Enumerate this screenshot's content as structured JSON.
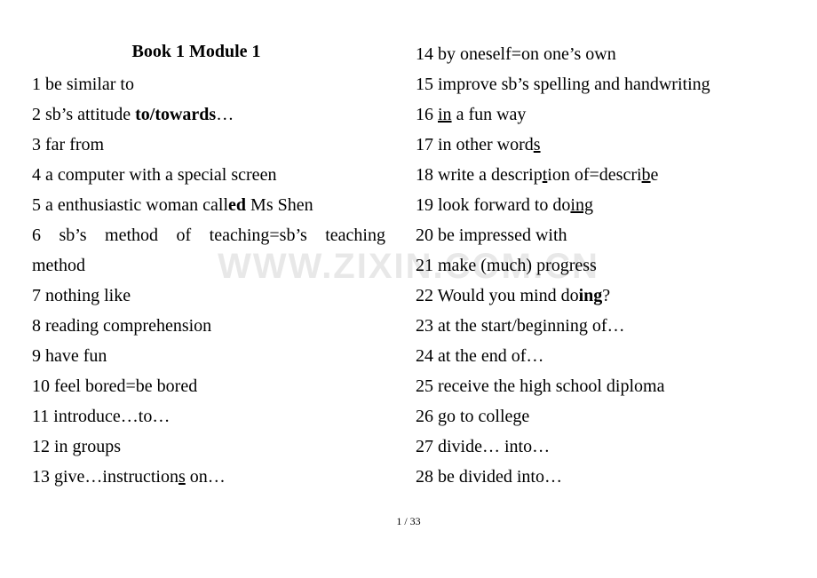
{
  "document": {
    "title": "Book 1 Module 1",
    "watermark": "WWW.ZIXIN.COM.CN",
    "footer": "1 / 33",
    "left_column": [
      "1 be similar to",
      "2 sb’s attitude to/towards…",
      "3 far from",
      "4 a computer with a special screen",
      "5 a enthusiastic woman called Ms Shen",
      "6  sb’s  method  of  teaching=sb’s  teaching",
      "method",
      "7 nothing like",
      "8 reading comprehension",
      "9 have fun",
      "10 feel bored=be bored",
      "11 introduce…to…",
      "12 in groups",
      "13 give…instructions on…"
    ],
    "right_column": [
      "14 by oneself=on one’s own",
      "15 improve sb’s spelling and handwriting",
      "16 in a fun way",
      "17 in other words",
      "18 write a description of=describe",
      "19 look forward to doing",
      "20 be impressed with",
      "21 make (much) progress",
      "22 Would you mind doing?",
      "23 at the start/beginning of…",
      "24 at the end of…",
      "25 receive the high school diploma",
      "26 go to college",
      "27 divide… into…",
      "28 be divided into…"
    ]
  }
}
